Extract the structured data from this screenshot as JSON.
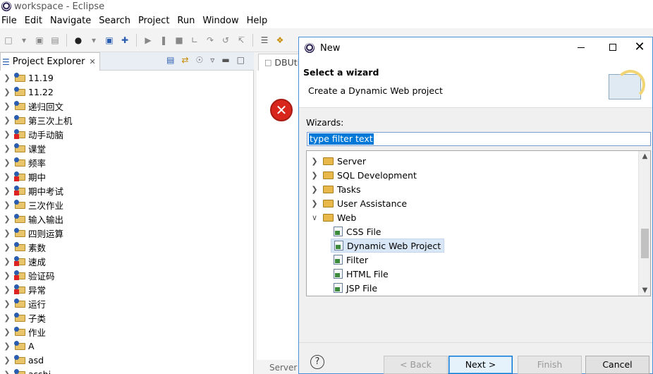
{
  "window": {
    "title": "workspace - Eclipse"
  },
  "menu": [
    "File",
    "Edit",
    "Navigate",
    "Search",
    "Project",
    "Run",
    "Window",
    "Help"
  ],
  "explorer": {
    "tab_label": "Project Explorer",
    "close_glyph": "✕",
    "projects": [
      {
        "name": "11.19",
        "error": false
      },
      {
        "name": "11.22",
        "error": false
      },
      {
        "name": "递归回文",
        "error": false
      },
      {
        "name": "第三次上机",
        "error": false
      },
      {
        "name": "动手动脑",
        "error": true
      },
      {
        "name": "课堂",
        "error": false
      },
      {
        "name": "频率",
        "error": false
      },
      {
        "name": "期中",
        "error": true
      },
      {
        "name": "期中考试",
        "error": true
      },
      {
        "name": "三次作业",
        "error": false
      },
      {
        "name": "输入输出",
        "error": false
      },
      {
        "name": "四则运算",
        "error": false
      },
      {
        "name": "素数",
        "error": false
      },
      {
        "name": "速成",
        "error": true
      },
      {
        "name": "验证码",
        "error": true
      },
      {
        "name": "异常",
        "error": true
      },
      {
        "name": "运行",
        "error": false
      },
      {
        "name": "子类",
        "error": false
      },
      {
        "name": "作业",
        "error": false
      },
      {
        "name": "A",
        "error": false
      },
      {
        "name": "asd",
        "error": false
      },
      {
        "name": "asshi",
        "error": false
      }
    ]
  },
  "editor": {
    "tab_label": "DBUti",
    "error_glyph": "✕",
    "bottom_tab": "Server"
  },
  "dialog": {
    "title": "New",
    "header_title": "Select a wizard",
    "header_desc": "Create a Dynamic Web project",
    "wizards_label": "Wizards:",
    "filter_value": "type filter text",
    "tree": [
      {
        "label": "Server",
        "type": "folder",
        "level": 0,
        "expanded": false
      },
      {
        "label": "SQL Development",
        "type": "folder",
        "level": 0,
        "expanded": false
      },
      {
        "label": "Tasks",
        "type": "folder",
        "level": 0,
        "expanded": false
      },
      {
        "label": "User Assistance",
        "type": "folder",
        "level": 0,
        "expanded": false
      },
      {
        "label": "Web",
        "type": "folder",
        "level": 0,
        "expanded": true
      },
      {
        "label": "CSS File",
        "type": "file",
        "level": 1,
        "selected": false
      },
      {
        "label": "Dynamic Web Project",
        "type": "file",
        "level": 1,
        "selected": true
      },
      {
        "label": "Filter",
        "type": "file",
        "level": 1,
        "selected": false
      },
      {
        "label": "HTML File",
        "type": "file",
        "level": 1,
        "selected": false
      },
      {
        "label": "JSP File",
        "type": "file",
        "level": 1,
        "selected": false
      }
    ],
    "buttons": {
      "help": "?",
      "back": "< Back",
      "next": "Next >",
      "finish": "Finish",
      "cancel": "Cancel"
    },
    "close_glyph": "✕"
  },
  "colors": {
    "selection": "#0078d7",
    "tree_selected": "#d9e6f5",
    "error": "#d9261c",
    "folder": "#e8b84a"
  }
}
